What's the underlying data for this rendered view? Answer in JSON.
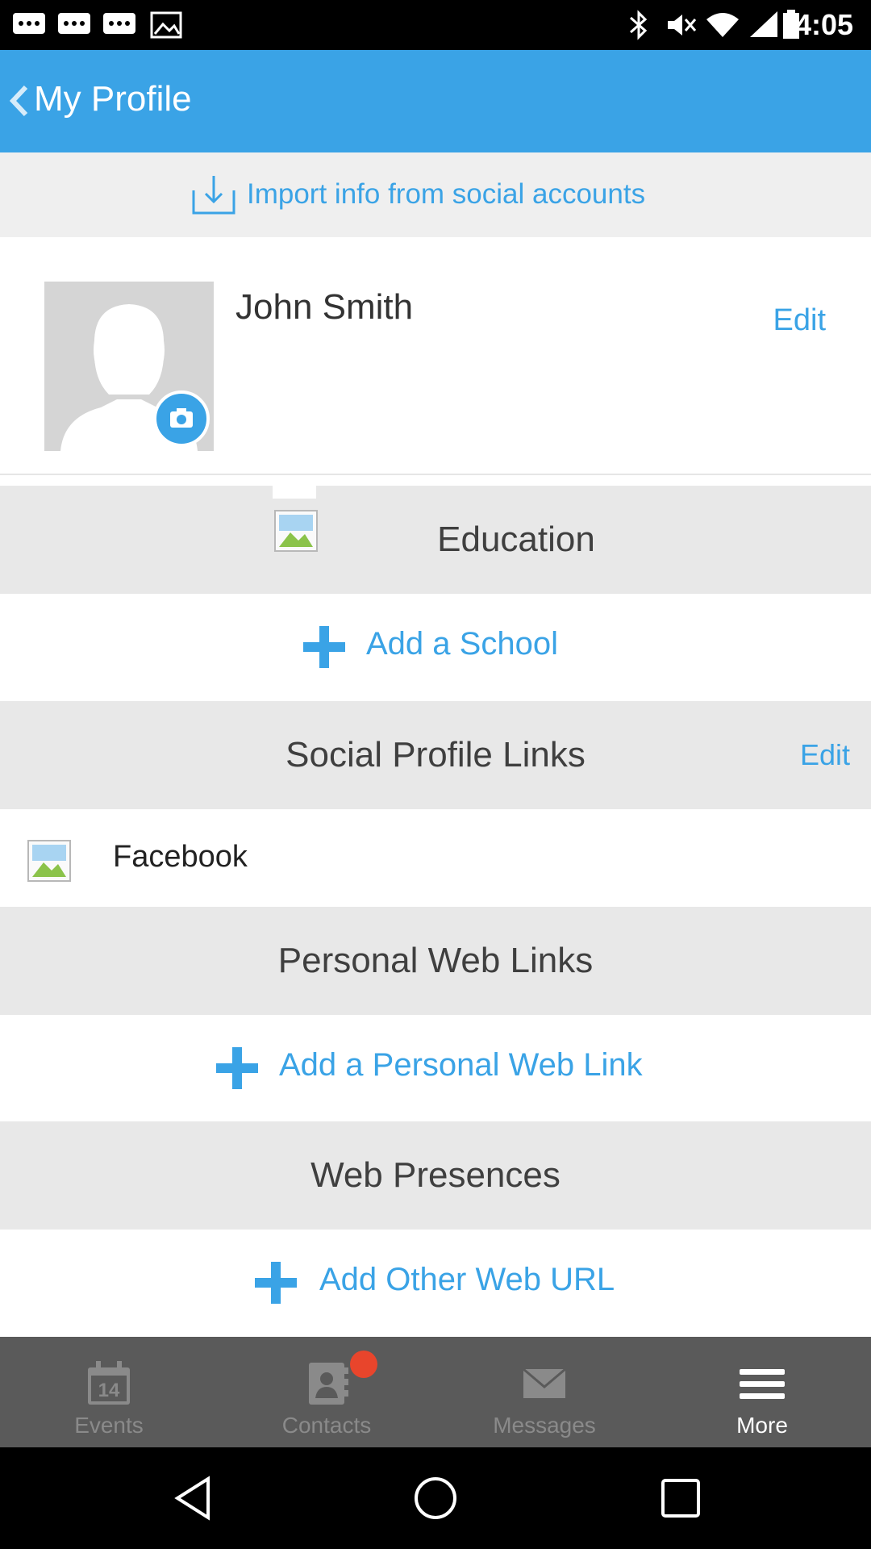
{
  "status_bar": {
    "time": "4:05"
  },
  "app_bar": {
    "title": "My Profile"
  },
  "import": {
    "label": "Import info from social accounts"
  },
  "profile": {
    "name": "John Smith",
    "edit_label": "Edit"
  },
  "education": {
    "header": "Education",
    "add_label": "Add a School"
  },
  "social_links": {
    "header": "Social Profile Links",
    "edit_label": "Edit",
    "items": [
      {
        "label": "Facebook"
      }
    ]
  },
  "personal_links": {
    "header": "Personal Web Links",
    "add_label": "Add a Personal Web Link"
  },
  "web_presences": {
    "header": "Web Presences",
    "add_label": "Add Other Web URL"
  },
  "bottom_nav": {
    "items": [
      {
        "label": "Events",
        "icon": "calendar-icon",
        "badge_number": "14"
      },
      {
        "label": "Contacts",
        "icon": "contacts-icon",
        "has_notification": true
      },
      {
        "label": "Messages",
        "icon": "envelope-icon"
      },
      {
        "label": "More",
        "icon": "menu-icon",
        "active": true
      }
    ]
  },
  "colors": {
    "accent": "#3aa3e6",
    "section_bg": "#e8e8e8",
    "nav_bg": "#5a5a5a",
    "notification": "#e8452c"
  }
}
